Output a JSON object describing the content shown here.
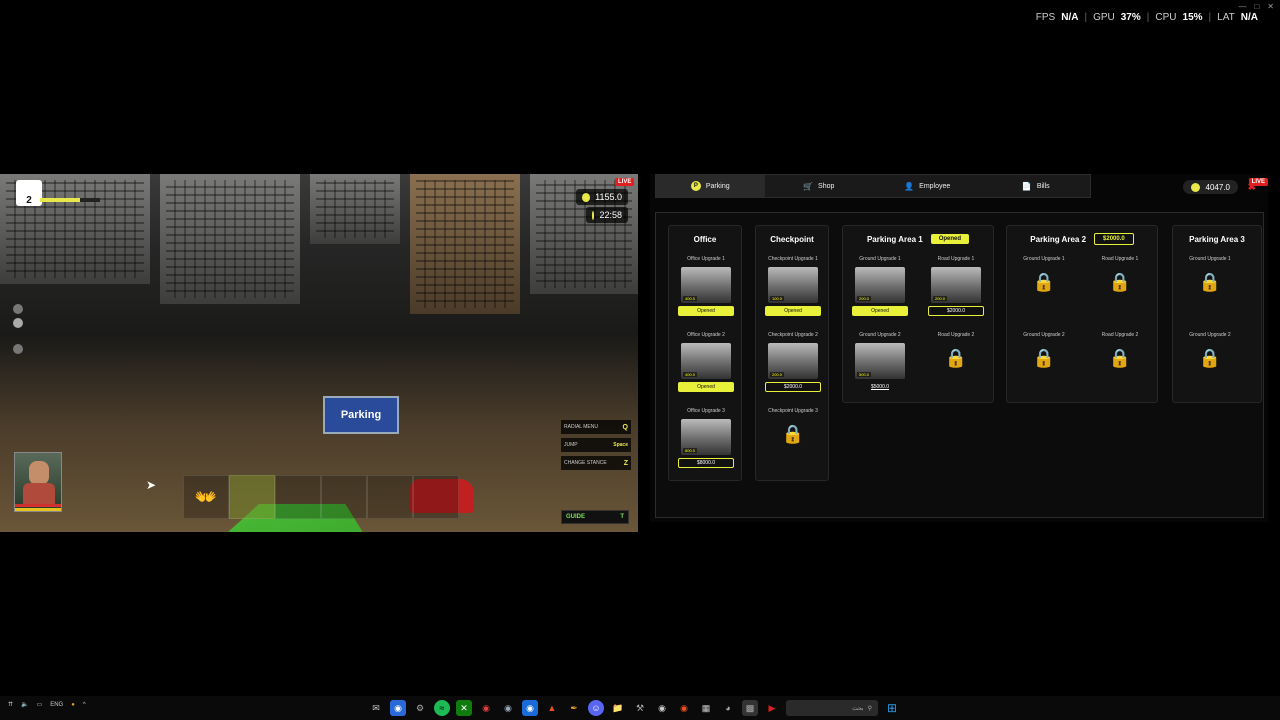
{
  "perf": {
    "fps_label": "FPS",
    "fps_value": "N/A",
    "gpu_label": "GPU",
    "gpu_value": "37",
    "cpu_label": "CPU",
    "cpu_value": "15",
    "lat_label": "LAT",
    "lat_value": "N/A",
    "percent": "%",
    "sep": "|"
  },
  "game": {
    "level": "2",
    "xp_progress": 0.66,
    "live_badge": "LIVE",
    "money": "1155.0",
    "clock": "22:58",
    "sign_text": "Parking",
    "hints": [
      {
        "label": "RADIAL MENU",
        "key": "Q"
      },
      {
        "label": "JUMP",
        "key": "Space"
      },
      {
        "label": "CHANGE STANCE",
        "key": "Z"
      }
    ],
    "guide_label": "GUIDE",
    "guide_key": "T",
    "hotbar_hand_icon": "👐"
  },
  "panel": {
    "tabs": [
      {
        "label": "Parking",
        "icon": "P"
      },
      {
        "label": "Shop",
        "icon": "cart-icon"
      },
      {
        "label": "Employee",
        "icon": "person-icon"
      },
      {
        "label": "Bills",
        "icon": "bill-icon"
      }
    ],
    "money": "4047.0",
    "live_badge": "LIVE",
    "close": "✖",
    "columns": [
      {
        "title": "Office",
        "tag": "",
        "cards": [
          {
            "name": "Office Upgrade 1",
            "status": "Opened",
            "type": "open",
            "price_tag": "400.0"
          },
          {
            "name": "Office Upgrade 2",
            "status": "Opened",
            "type": "open",
            "price_tag": "400.0"
          },
          {
            "name": "Office Upgrade 3",
            "status": "$8000.0",
            "type": "price",
            "price_tag": "800.0"
          }
        ]
      },
      {
        "title": "Checkpoint",
        "tag": "",
        "cards": [
          {
            "name": "Checkpoint Upgrade 1",
            "status": "Opened",
            "type": "open",
            "price_tag": "100.0"
          },
          {
            "name": "Checkpoint Upgrade 2",
            "status": "$2000.0",
            "type": "price",
            "price_tag": "200.0"
          },
          {
            "name": "Checkpoint Upgrade 3",
            "status": "",
            "type": "locked"
          }
        ]
      },
      {
        "title": "Parking Area 1",
        "tag": "Opened",
        "tag_type": "open",
        "cards": [
          {
            "name": "Ground Upgrade 1",
            "status": "Opened",
            "type": "open",
            "price_tag": "200.0"
          },
          {
            "name": "Road Upgrade 1",
            "status": "$2000.0",
            "type": "price",
            "price_tag": "200.0"
          },
          {
            "name": "Ground Upgrade 2",
            "status": "$5000.0",
            "type": "plain",
            "price_tag": "500.0"
          },
          {
            "name": "Road Upgrade 2",
            "status": "",
            "type": "locked"
          }
        ]
      },
      {
        "title": "Parking Area 2",
        "tag": "$2000.0",
        "tag_type": "price",
        "cards": [
          {
            "name": "Ground Upgrade 1",
            "status": "",
            "type": "locked"
          },
          {
            "name": "Road Upgrade 1",
            "status": "",
            "type": "locked"
          },
          {
            "name": "Ground Upgrade 2",
            "status": "",
            "type": "locked"
          },
          {
            "name": "Road Upgrade 2",
            "status": "",
            "type": "locked"
          }
        ]
      },
      {
        "title": "Parking Area 3",
        "tag": "",
        "cards": [
          {
            "name": "Ground Upgrade 1",
            "status": "",
            "type": "locked"
          },
          {
            "name": "Ground Upgrade 2",
            "status": "",
            "type": "locked"
          }
        ]
      }
    ],
    "lock_icon": "🔒"
  },
  "taskbar": {
    "lang": "ENG",
    "search_placeholder": "بحث"
  }
}
